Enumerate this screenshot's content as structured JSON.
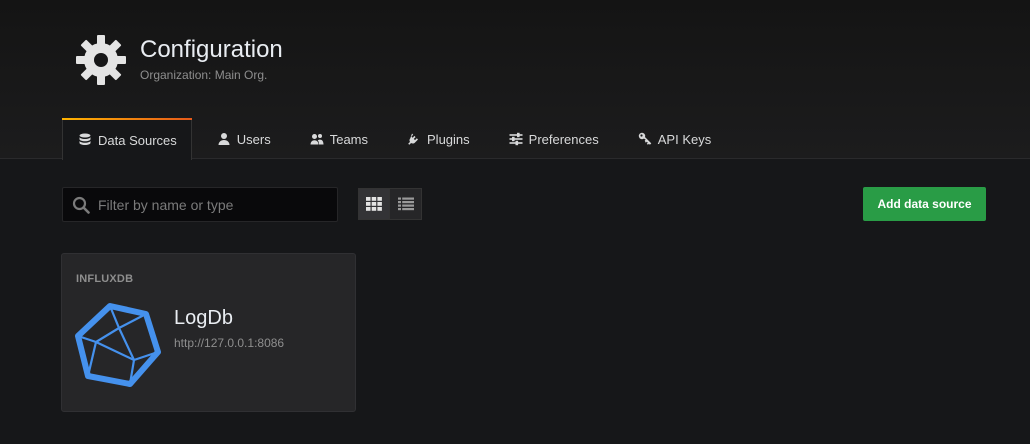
{
  "header": {
    "title": "Configuration",
    "subtitle": "Organization: Main Org."
  },
  "tabs": [
    {
      "label": "Data Sources",
      "icon": "database-icon",
      "active": true
    },
    {
      "label": "Users",
      "icon": "user-icon",
      "active": false
    },
    {
      "label": "Teams",
      "icon": "users-icon",
      "active": false
    },
    {
      "label": "Plugins",
      "icon": "plug-icon",
      "active": false
    },
    {
      "label": "Preferences",
      "icon": "sliders-icon",
      "active": false
    },
    {
      "label": "API Keys",
      "icon": "key-icon",
      "active": false
    }
  ],
  "toolbar": {
    "search_placeholder": "Filter by name or type",
    "search_value": "",
    "add_label": "Add data source",
    "layout": "grid"
  },
  "datasources": [
    {
      "type": "INFLUXDB",
      "name": "LogDb",
      "url": "http://127.0.0.1:8086",
      "logo": "influxdb-logo"
    }
  ],
  "colors": {
    "accent_green": "#299c46",
    "tab_gradient_start": "#ffb400",
    "tab_gradient_end": "#e65a1a",
    "influx_blue": "#4591ed"
  }
}
